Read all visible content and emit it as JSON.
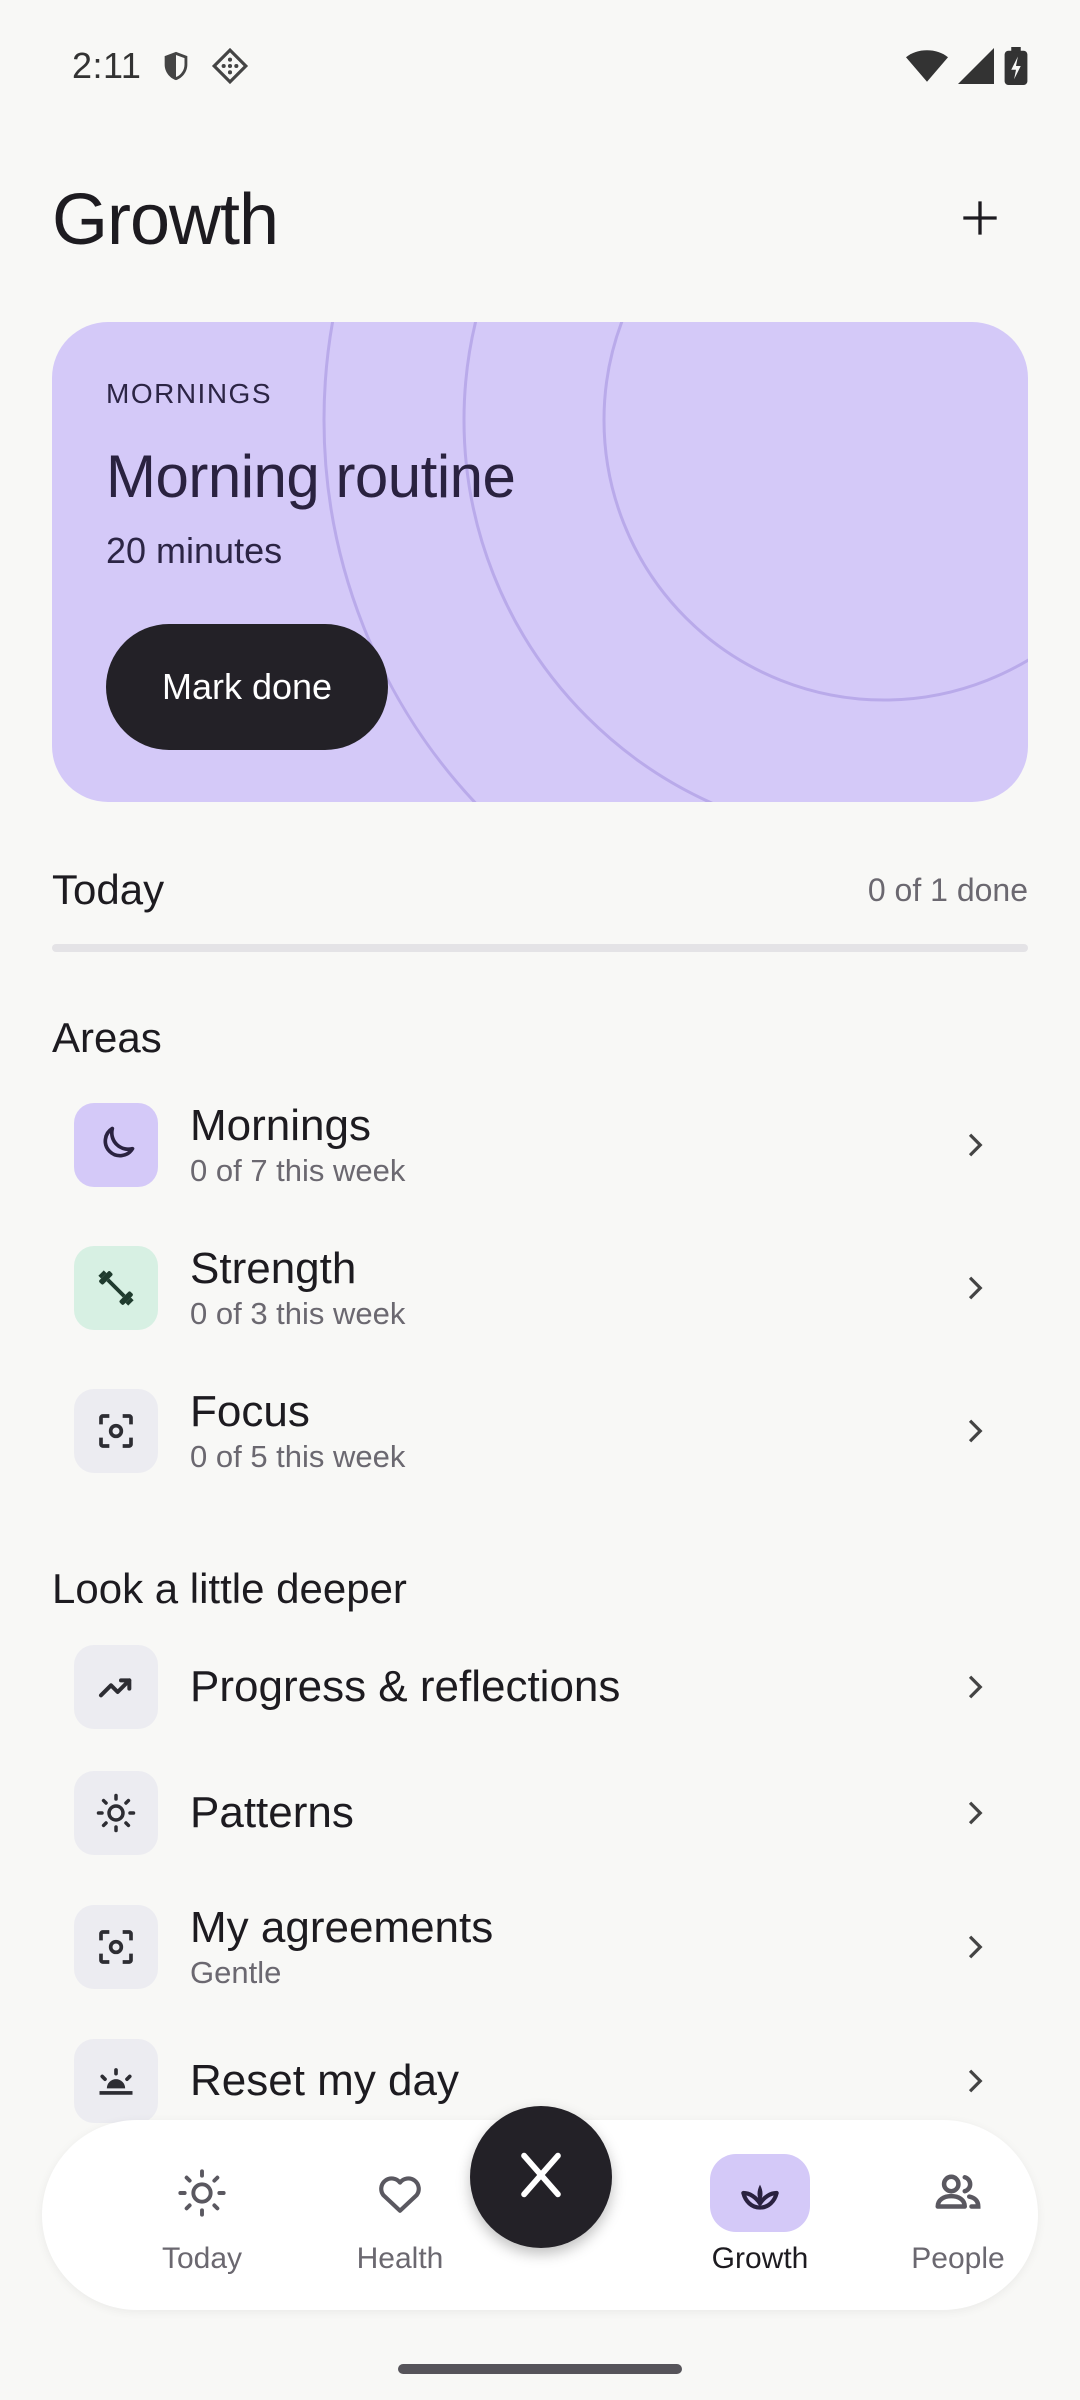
{
  "status_bar": {
    "time": "2:11",
    "icons": [
      "shield-icon",
      "dice-icon",
      "wifi-icon",
      "signal-icon",
      "battery-charging-icon"
    ]
  },
  "header": {
    "title": "Growth",
    "add_icon": "plus-icon"
  },
  "hero": {
    "eyebrow": "MORNINGS",
    "title": "Morning routine",
    "subtitle": "20 minutes",
    "button_label": "Mark done",
    "color": "#d4c9f8"
  },
  "today": {
    "label": "Today",
    "count": "0 of 1 done",
    "progress": 0
  },
  "areas": {
    "title": "Areas",
    "items": [
      {
        "title": "Mornings",
        "subtitle": "0 of 7 this week",
        "icon": "moon-icon",
        "color": "#d4c9f8"
      },
      {
        "title": "Strength",
        "subtitle": "0 of 3 this week",
        "icon": "dumbbell-icon",
        "color": "#d7f0e3"
      },
      {
        "title": "Focus",
        "subtitle": "0 of 5 this week",
        "icon": "center-focus-icon",
        "color": "#ececf1"
      }
    ]
  },
  "deeper": {
    "title": "Look a little deeper",
    "items": [
      {
        "title": "Progress & reflections",
        "subtitle": "",
        "icon": "trending-up-icon"
      },
      {
        "title": "Patterns",
        "subtitle": "",
        "icon": "sun-icon"
      },
      {
        "title": "My agreements",
        "subtitle": "Gentle",
        "icon": "center-focus-icon"
      },
      {
        "title": "Reset my day",
        "subtitle": "",
        "icon": "sunrise-icon"
      }
    ]
  },
  "nav": {
    "items": [
      {
        "label": "Today",
        "icon": "sun-icon"
      },
      {
        "label": "Health",
        "icon": "heart-icon"
      },
      {
        "label": "Growth",
        "icon": "sprout-icon",
        "active": true
      },
      {
        "label": "People",
        "icon": "people-icon"
      }
    ],
    "fab_icon": "close-icon"
  }
}
